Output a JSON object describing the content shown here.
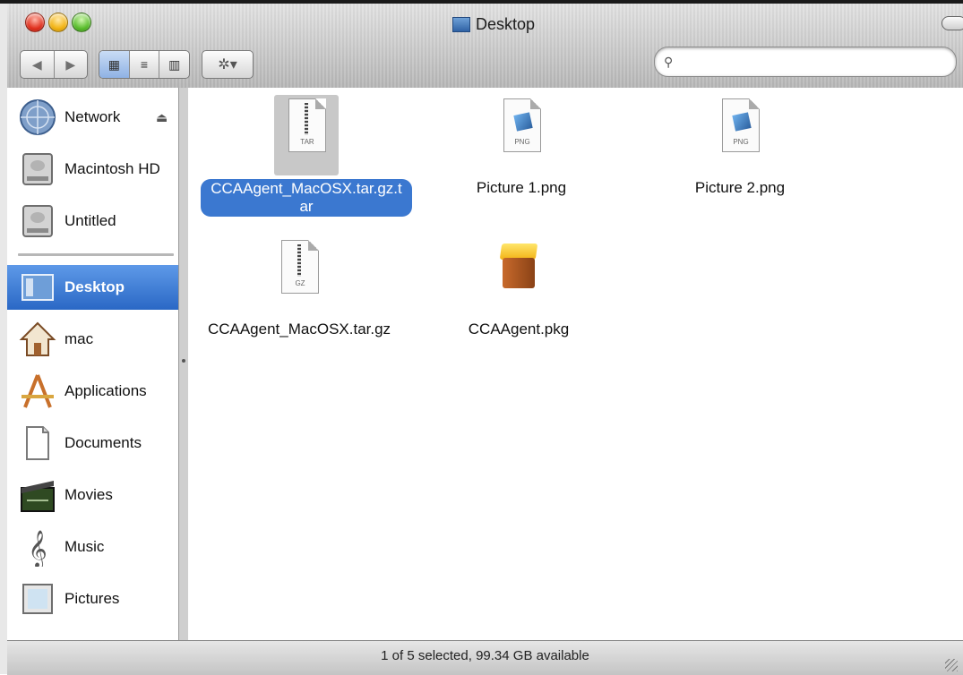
{
  "window": {
    "title": "Desktop"
  },
  "toolbar": {
    "back_glyph": "◀",
    "forward_glyph": "▶",
    "view_icon": "▦",
    "view_list": "≡",
    "view_columns": "▥",
    "action_glyph": "✲▾",
    "search_placeholder": ""
  },
  "sidebar": {
    "items": [
      {
        "label": "Network",
        "icon": "network-globe-icon"
      },
      {
        "label": "Macintosh HD",
        "icon": "hard-disk-icon"
      },
      {
        "label": "Untitled",
        "icon": "hard-disk-icon"
      },
      {
        "label": "Desktop",
        "icon": "desktop-icon",
        "selected": true
      },
      {
        "label": "mac",
        "icon": "home-icon"
      },
      {
        "label": "Applications",
        "icon": "applications-icon"
      },
      {
        "label": "Documents",
        "icon": "documents-icon"
      },
      {
        "label": "Movies",
        "icon": "movies-icon"
      },
      {
        "label": "Music",
        "icon": "music-icon"
      },
      {
        "label": "Pictures",
        "icon": "pictures-icon"
      }
    ]
  },
  "files": [
    {
      "name": "CCAAgent_MacOSX.tar.gz.tar",
      "type": "TAR",
      "selected": true
    },
    {
      "name": "Picture 1.png",
      "type": "PNG"
    },
    {
      "name": "Picture 2.png",
      "type": "PNG"
    },
    {
      "name": "CCAAgent_MacOSX.tar.gz",
      "type": "GZ"
    },
    {
      "name": "CCAAgent.pkg",
      "type": "pkg"
    }
  ],
  "status": {
    "text": "1 of 5 selected, 99.34 GB available"
  },
  "colors": {
    "selection": "#3b78d0",
    "sidebar_selected": "#2a68c5"
  }
}
